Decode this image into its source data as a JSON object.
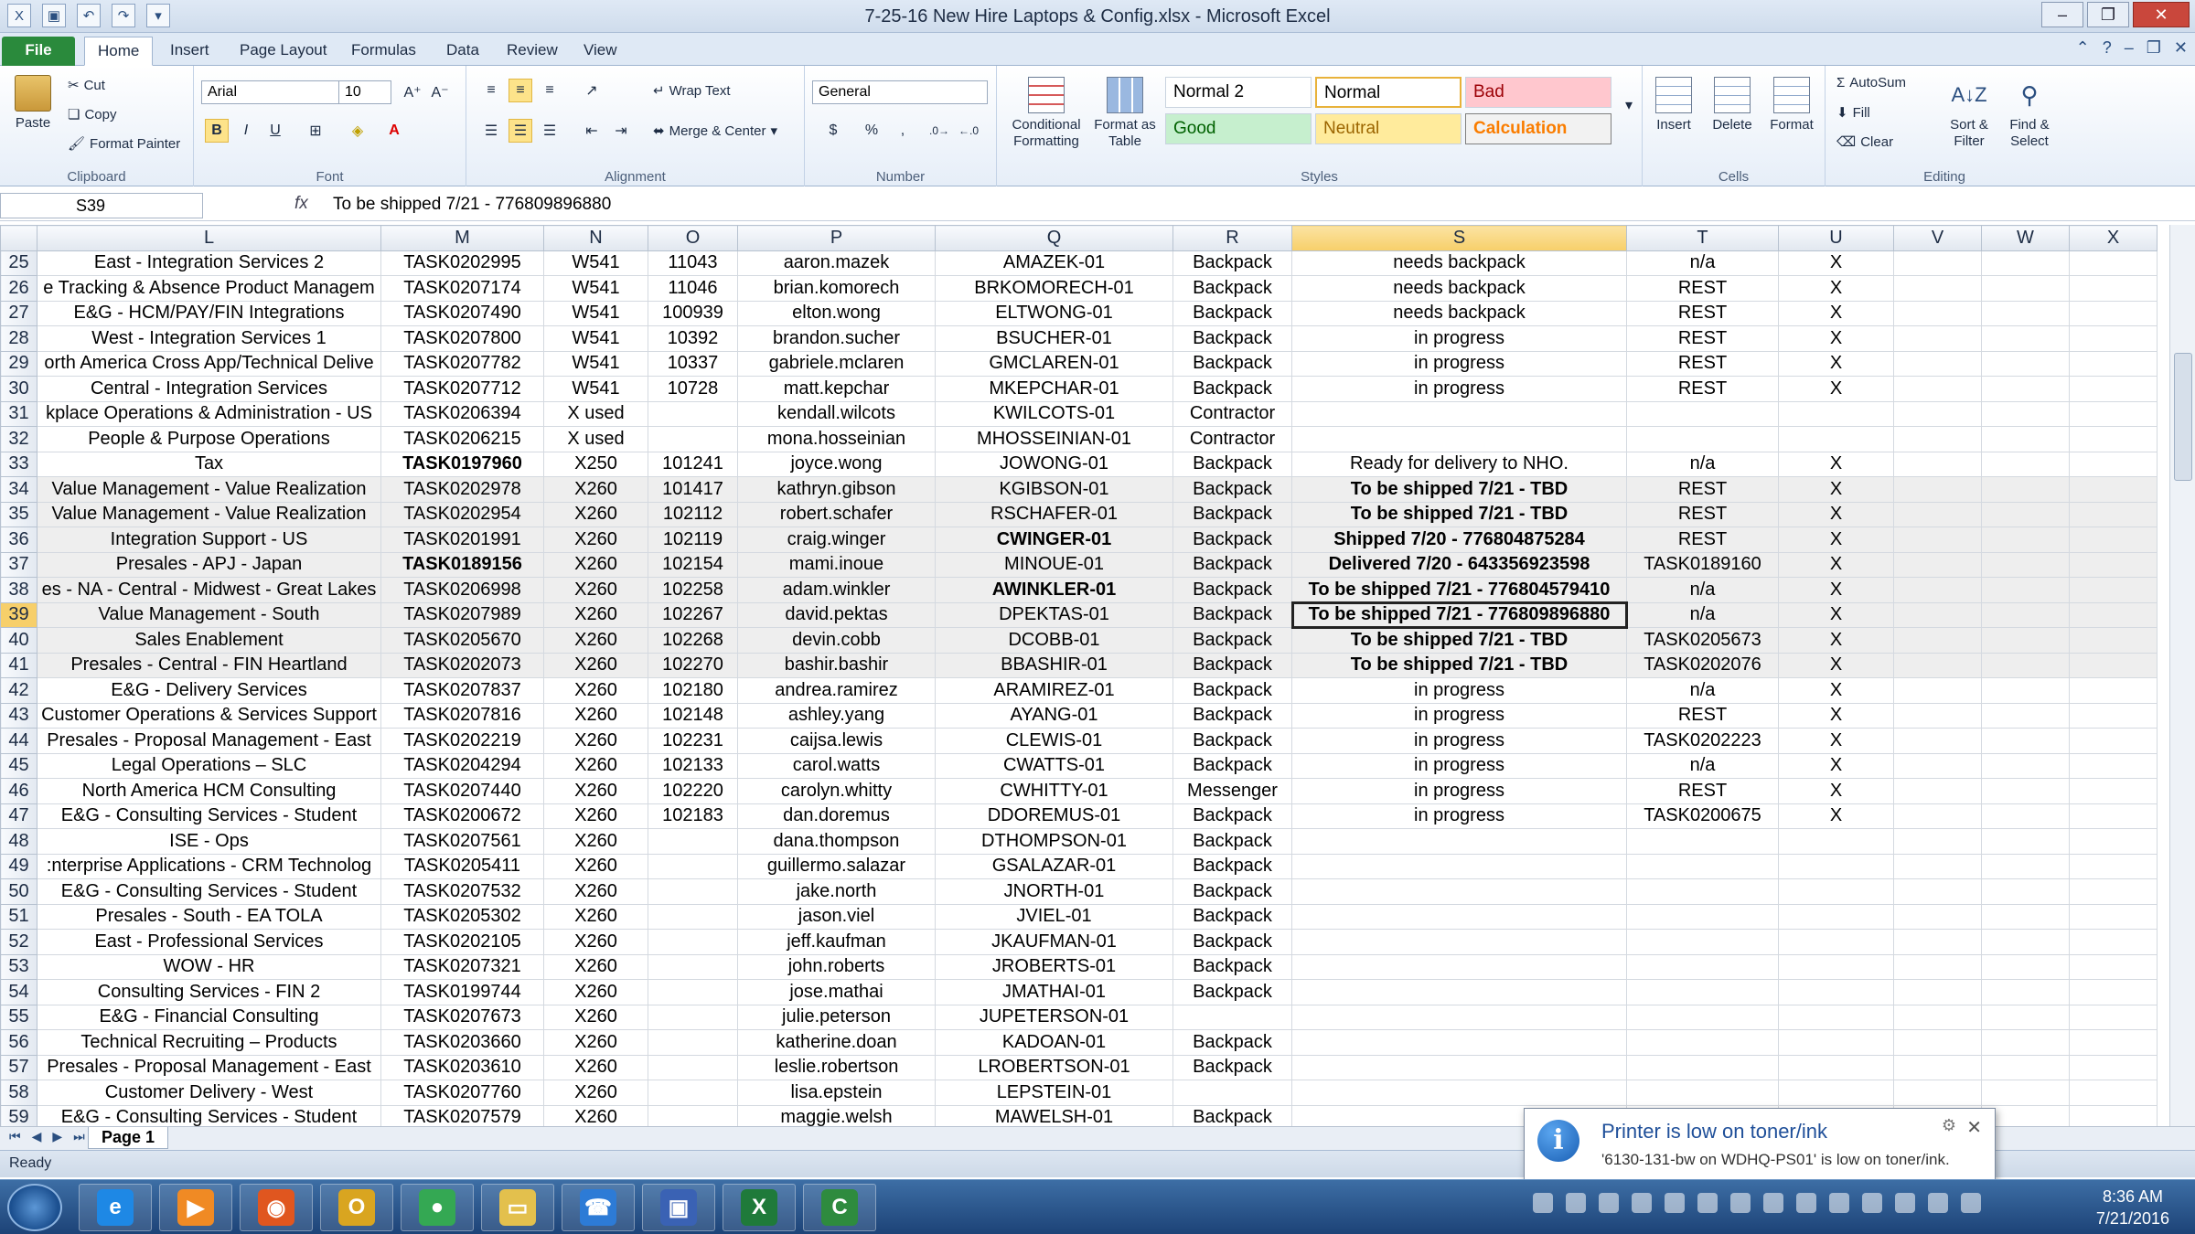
{
  "window": {
    "title": "7-25-16 New Hire Laptops & Config.xlsx - Microsoft Excel"
  },
  "tabs": [
    "File",
    "Home",
    "Insert",
    "Page Layout",
    "Formulas",
    "Data",
    "Review",
    "View"
  ],
  "ribbon": {
    "clipboard": {
      "label": "Clipboard",
      "paste": "Paste",
      "cut": "Cut",
      "copy": "Copy",
      "format_painter": "Format Painter"
    },
    "font": {
      "label": "Font",
      "name": "Arial",
      "size": "10"
    },
    "alignment": {
      "label": "Alignment",
      "wrap_text": "Wrap Text",
      "merge_center": "Merge & Center"
    },
    "number": {
      "label": "Number",
      "format": "General",
      "currency": "$",
      "percent": "%",
      "comma": ","
    },
    "styles": {
      "label": "Styles",
      "conditional_formatting": "Conditional Formatting",
      "format_as_table": "Format as Table",
      "cells": [
        {
          "name": "Normal 2",
          "bg": "#ffffff",
          "fg": "#000000"
        },
        {
          "name": "Normal",
          "bg": "#ffffff",
          "fg": "#000000"
        },
        {
          "name": "Bad",
          "bg": "#ffc7ce",
          "fg": "#9c0006"
        },
        {
          "name": "Good",
          "bg": "#c6efce",
          "fg": "#006100"
        },
        {
          "name": "Neutral",
          "bg": "#ffeb9c",
          "fg": "#9c6500"
        },
        {
          "name": "Calculation",
          "bg": "#f2f2f2",
          "fg": "#fa7d00"
        }
      ]
    },
    "cells": {
      "label": "Cells",
      "insert": "Insert",
      "delete": "Delete",
      "format": "Format"
    },
    "editing": {
      "label": "Editing",
      "autosum": "AutoSum",
      "fill": "Fill",
      "clear": "Clear",
      "sort_filter": "Sort & Filter",
      "find_select": "Find & Select"
    }
  },
  "formula_bar": {
    "name_box": "S39",
    "fx": "fx",
    "content": "To be shipped 7/21 - 776809896880"
  },
  "columns": [
    "L",
    "M",
    "N",
    "O",
    "P",
    "Q",
    "R",
    "S",
    "T",
    "U",
    "V",
    "W",
    "X"
  ],
  "selected_column": "S",
  "selected_row": "39",
  "rows": [
    {
      "n": "25",
      "shade": false,
      "bold": [],
      "c": [
        "East - Integration Services 2",
        "TASK0202995",
        "W541",
        "11043",
        "aaron.mazek",
        "AMAZEK-01",
        "Backpack",
        "needs backpack",
        "n/a",
        "X"
      ]
    },
    {
      "n": "26",
      "shade": false,
      "bold": [],
      "c": [
        "e Tracking & Absence Product Managem",
        "TASK0207174",
        "W541",
        "11046",
        "brian.komorech",
        "BRKOMORECH-01",
        "Backpack",
        "needs backpack",
        "REST",
        "X"
      ]
    },
    {
      "n": "27",
      "shade": false,
      "bold": [],
      "c": [
        "E&G - HCM/PAY/FIN Integrations",
        "TASK0207490",
        "W541",
        "100939",
        "elton.wong",
        "ELTWONG-01",
        "Backpack",
        "needs backpack",
        "REST",
        "X"
      ]
    },
    {
      "n": "28",
      "shade": false,
      "bold": [],
      "c": [
        "West - Integration Services 1",
        "TASK0207800",
        "W541",
        "10392",
        "brandon.sucher",
        "BSUCHER-01",
        "Backpack",
        "in progress",
        "REST",
        "X"
      ]
    },
    {
      "n": "29",
      "shade": false,
      "bold": [],
      "c": [
        "orth America Cross App/Technical Delive",
        "TASK0207782",
        "W541",
        "10337",
        "gabriele.mclaren",
        "GMCLAREN-01",
        "Backpack",
        "in progress",
        "REST",
        "X"
      ]
    },
    {
      "n": "30",
      "shade": false,
      "bold": [],
      "c": [
        "Central - Integration Services",
        "TASK0207712",
        "W541",
        "10728",
        "matt.kepchar",
        "MKEPCHAR-01",
        "Backpack",
        "in progress",
        "REST",
        "X"
      ]
    },
    {
      "n": "31",
      "shade": false,
      "bold": [],
      "c": [
        "kplace Operations & Administration - US",
        "TASK0206394",
        "X used",
        "",
        "kendall.wilcots",
        "KWILCOTS-01",
        "Contractor",
        "",
        "",
        ""
      ]
    },
    {
      "n": "32",
      "shade": false,
      "bold": [],
      "c": [
        "People & Purpose Operations",
        "TASK0206215",
        "X used",
        "",
        "mona.hosseinian",
        "MHOSSEINIAN-01",
        "Contractor",
        "",
        "",
        ""
      ]
    },
    {
      "n": "33",
      "shade": false,
      "bold": [
        1
      ],
      "c": [
        "Tax",
        "TASK0197960",
        "X250",
        "101241",
        "joyce.wong",
        "JOWONG-01",
        "Backpack",
        "Ready for delivery to NHO.",
        "n/a",
        "X"
      ]
    },
    {
      "n": "34",
      "shade": true,
      "bold": [
        7
      ],
      "c": [
        "Value Management - Value Realization",
        "TASK0202978",
        "X260",
        "101417",
        "kathryn.gibson",
        "KGIBSON-01",
        "Backpack",
        "To be shipped 7/21 - TBD",
        "REST",
        "X"
      ]
    },
    {
      "n": "35",
      "shade": true,
      "bold": [
        7
      ],
      "c": [
        "Value Management - Value Realization",
        "TASK0202954",
        "X260",
        "102112",
        "robert.schafer",
        "RSCHAFER-01",
        "Backpack",
        "To be shipped 7/21 - TBD",
        "REST",
        "X"
      ]
    },
    {
      "n": "36",
      "shade": true,
      "bold": [
        5,
        7
      ],
      "c": [
        "Integration Support - US",
        "TASK0201991",
        "X260",
        "102119",
        "craig.winger",
        "CWINGER-01",
        "Backpack",
        "Shipped 7/20 -  776804875284",
        "REST",
        "X"
      ]
    },
    {
      "n": "37",
      "shade": true,
      "bold": [
        1,
        7
      ],
      "c": [
        "Presales - APJ - Japan",
        "TASK0189156",
        "X260",
        "102154",
        "mami.inoue",
        "MINOUE-01",
        "Backpack",
        "Delivered 7/20 - 643356923598",
        "TASK0189160",
        "X"
      ]
    },
    {
      "n": "38",
      "shade": true,
      "bold": [
        5,
        7
      ],
      "c": [
        "es - NA - Central - Midwest - Great Lakes",
        "TASK0206998",
        "X260",
        "102258",
        "adam.winkler",
        "AWINKLER-01",
        "Backpack",
        "To be shipped 7/21 - 776804579410",
        "n/a",
        "X"
      ]
    },
    {
      "n": "39",
      "shade": true,
      "bold": [
        7
      ],
      "c": [
        "Value Management - South",
        "TASK0207989",
        "X260",
        "102267",
        "david.pektas",
        "DPEKTAS-01",
        "Backpack",
        "To be shipped 7/21 - 776809896880",
        "n/a",
        "X"
      ]
    },
    {
      "n": "40",
      "shade": true,
      "bold": [
        7
      ],
      "c": [
        "Sales Enablement",
        "TASK0205670",
        "X260",
        "102268",
        "devin.cobb",
        "DCOBB-01",
        "Backpack",
        "To be shipped 7/21 - TBD",
        "TASK0205673",
        "X"
      ]
    },
    {
      "n": "41",
      "shade": true,
      "bold": [
        7
      ],
      "c": [
        "Presales - Central - FIN Heartland",
        "TASK0202073",
        "X260",
        "102270",
        "bashir.bashir",
        "BBASHIR-01",
        "Backpack",
        "To be shipped 7/21 - TBD",
        "TASK0202076",
        "X"
      ]
    },
    {
      "n": "42",
      "shade": false,
      "bold": [],
      "c": [
        "E&G - Delivery Services",
        "TASK0207837",
        "X260",
        "102180",
        "andrea.ramirez",
        "ARAMIREZ-01",
        "Backpack",
        "in progress",
        "n/a",
        "X"
      ]
    },
    {
      "n": "43",
      "shade": false,
      "bold": [],
      "c": [
        "Customer Operations & Services Support",
        "TASK0207816",
        "X260",
        "102148",
        "ashley.yang",
        "AYANG-01",
        "Backpack",
        "in progress",
        "REST",
        "X"
      ]
    },
    {
      "n": "44",
      "shade": false,
      "bold": [],
      "c": [
        "Presales - Proposal Management - East",
        "TASK0202219",
        "X260",
        "102231",
        "caijsa.lewis",
        "CLEWIS-01",
        "Backpack",
        "in progress",
        "TASK0202223",
        "X"
      ]
    },
    {
      "n": "45",
      "shade": false,
      "bold": [],
      "c": [
        "Legal Operations – SLC",
        "TASK0204294",
        "X260",
        "102133",
        "carol.watts",
        "CWATTS-01",
        "Backpack",
        "in progress",
        "n/a",
        "X"
      ]
    },
    {
      "n": "46",
      "shade": false,
      "bold": [],
      "c": [
        "North America HCM Consulting",
        "TASK0207440",
        "X260",
        "102220",
        "carolyn.whitty",
        "CWHITTY-01",
        "Messenger",
        "in progress",
        "REST",
        "X"
      ]
    },
    {
      "n": "47",
      "shade": false,
      "bold": [],
      "c": [
        "E&G - Consulting Services - Student",
        "TASK0200672",
        "X260",
        "102183",
        "dan.doremus",
        "DDOREMUS-01",
        "Backpack",
        "in progress",
        "TASK0200675",
        "X"
      ]
    },
    {
      "n": "48",
      "shade": false,
      "bold": [],
      "c": [
        "ISE - Ops",
        "TASK0207561",
        "X260",
        "",
        "dana.thompson",
        "DTHOMPSON-01",
        "Backpack",
        "",
        "",
        ""
      ]
    },
    {
      "n": "49",
      "shade": false,
      "bold": [],
      "c": [
        ":nterprise Applications - CRM Technolog",
        "TASK0205411",
        "X260",
        "",
        "guillermo.salazar",
        "GSALAZAR-01",
        "Backpack",
        "",
        "",
        ""
      ]
    },
    {
      "n": "50",
      "shade": false,
      "bold": [],
      "c": [
        "E&G - Consulting Services - Student",
        "TASK0207532",
        "X260",
        "",
        "jake.north",
        "JNORTH-01",
        "Backpack",
        "",
        "",
        ""
      ]
    },
    {
      "n": "51",
      "shade": false,
      "bold": [],
      "c": [
        "Presales - South - EA TOLA",
        "TASK0205302",
        "X260",
        "",
        "jason.viel",
        "JVIEL-01",
        "Backpack",
        "",
        "",
        ""
      ]
    },
    {
      "n": "52",
      "shade": false,
      "bold": [],
      "c": [
        "East - Professional Services",
        "TASK0202105",
        "X260",
        "",
        "jeff.kaufman",
        "JKAUFMAN-01",
        "Backpack",
        "",
        "",
        ""
      ]
    },
    {
      "n": "53",
      "shade": false,
      "bold": [],
      "c": [
        "WOW - HR",
        "TASK0207321",
        "X260",
        "",
        "john.roberts",
        "JROBERTS-01",
        "Backpack",
        "",
        "",
        ""
      ]
    },
    {
      "n": "54",
      "shade": false,
      "bold": [],
      "c": [
        "Consulting Services - FIN 2",
        "TASK0199744",
        "X260",
        "",
        "jose.mathai",
        "JMATHAI-01",
        "Backpack",
        "",
        "",
        ""
      ]
    },
    {
      "n": "55",
      "shade": false,
      "bold": [],
      "c": [
        "E&G - Financial Consulting",
        "TASK0207673",
        "X260",
        "",
        "julie.peterson",
        "JUPETERSON-01",
        "",
        "",
        "",
        ""
      ]
    },
    {
      "n": "56",
      "shade": false,
      "bold": [],
      "c": [
        "Technical Recruiting – Products",
        "TASK0203660",
        "X260",
        "",
        "katherine.doan",
        "KADOAN-01",
        "Backpack",
        "",
        "",
        ""
      ]
    },
    {
      "n": "57",
      "shade": false,
      "bold": [],
      "c": [
        "Presales - Proposal Management - East",
        "TASK0203610",
        "X260",
        "",
        "leslie.robertson",
        "LROBERTSON-01",
        "Backpack",
        "",
        "",
        ""
      ]
    },
    {
      "n": "58",
      "shade": false,
      "bold": [],
      "c": [
        "Customer Delivery - West",
        "TASK0207760",
        "X260",
        "",
        "lisa.epstein",
        "LEPSTEIN-01",
        "",
        "",
        "",
        ""
      ]
    },
    {
      "n": "59",
      "shade": false,
      "bold": [],
      "c": [
        "E&G - Consulting Services - Student",
        "TASK0207579",
        "X260",
        "",
        "maggie.welsh",
        "MAWELSH-01",
        "Backpack",
        "",
        "",
        ""
      ]
    }
  ],
  "sheet_tab": "Page 1",
  "status": "Ready",
  "notification": {
    "title": "Printer is low on toner/ink",
    "message": "'6130-131-bw on WDHQ-PS01' is low on toner/ink."
  },
  "clock": {
    "time": "8:36 AM",
    "date": "7/21/2016"
  },
  "taskbar_apps": [
    {
      "name": "internet-explorer",
      "color": "#1e88e5",
      "glyph": "e"
    },
    {
      "name": "media-player",
      "color": "#f08a24",
      "glyph": "▶"
    },
    {
      "name": "firefox",
      "color": "#e0561f",
      "glyph": "◉"
    },
    {
      "name": "outlook",
      "color": "#d9a520",
      "glyph": "O"
    },
    {
      "name": "chrome",
      "color": "#34a853",
      "glyph": "●"
    },
    {
      "name": "file-explorer",
      "color": "#e3c04d",
      "glyph": "▭"
    },
    {
      "name": "communicator",
      "color": "#2d7bd6",
      "glyph": "☎"
    },
    {
      "name": "remote-desktop",
      "color": "#3a62b4",
      "glyph": "▣"
    },
    {
      "name": "excel",
      "color": "#1f7a3a",
      "glyph": "X"
    },
    {
      "name": "citrix",
      "color": "#2e8b3e",
      "glyph": "C"
    }
  ]
}
